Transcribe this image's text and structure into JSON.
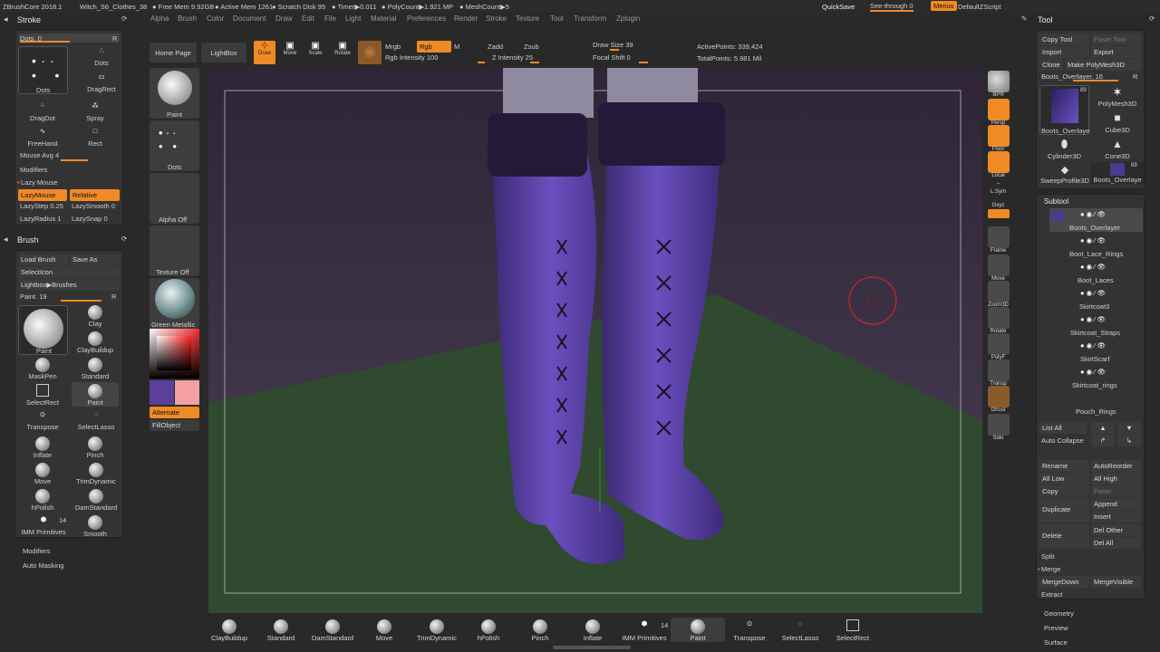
{
  "titlebar": {
    "app": "ZBrushCore 2018.1",
    "doc": "Witch_S6_Clothes_38",
    "free_mem": "● Free Mem 9.92GB",
    "active_mem": "● Active Mem 1261",
    "scratch": "● Scratch Disk 95",
    "timer": "● Timer▶0.011",
    "polycount": "● PolyCount▶1.921 MP",
    "meshcount": "● MeshCount▶5",
    "quicksave": "QuickSave",
    "seethrough": "See-through  0",
    "menus": "Menus",
    "script": "DefaultZScript"
  },
  "menubar": [
    "Alpha",
    "Brush",
    "Color",
    "Document",
    "Draw",
    "Edit",
    "File",
    "Light",
    "Material",
    "Preferences",
    "Render",
    "Stroke",
    "Texture",
    "Tool",
    "Transform",
    "Zplugin"
  ],
  "stroke": {
    "title": "Stroke",
    "dots_slider": "Dots. 0",
    "r": "R",
    "items": [
      "Dots",
      "Dots",
      "DragRect",
      "DragDot",
      "Spray",
      "FreeHand",
      "Rect"
    ],
    "mouse_avg": "Mouse Avg 4",
    "modifiers": "Modifiers",
    "lazy_mouse": "Lazy Mouse",
    "lazymouse_btn": "LazyMouse",
    "relative_btn": "Relative",
    "lazystep": "LazyStep 0.25",
    "lazysmooth": "LazySmooth 0",
    "lazyradius": "LazyRadius 1",
    "lazysnap": "LazySnap 0"
  },
  "brush": {
    "title": "Brush",
    "load": "Load Brush",
    "save": "Save As",
    "selecticon": "SelectIcon",
    "lightbox": "Lightbox▶Brushes",
    "paint_slider": "Paint. 19",
    "r": "R",
    "items": [
      "Paint",
      "Clay",
      "ClayBuildup",
      "MaskPen",
      "Standard",
      "SelectRect",
      "Paint",
      "Transpose",
      "SelectLasso",
      "Inflate",
      "Pinch",
      "Move",
      "TrimDynamic",
      "hPolish",
      "DamStandard",
      "IMM Primitives",
      "Smooth"
    ],
    "imm_count": "14",
    "modifiers": "Modifiers",
    "auto_masking": "Auto Masking"
  },
  "leftshelf": {
    "paint": "Paint",
    "dots": "Dots",
    "alpha": "Alpha Off",
    "texture": "Texture Off",
    "material": "Green Metallic",
    "alternate": "Alternate",
    "fillobject": "FillObject"
  },
  "topbar": {
    "home": "Home Page",
    "lightbox": "LightBox",
    "draw": "Draw",
    "move": "Move",
    "scale": "Scale",
    "rotate": "Rotate",
    "mrgb": "Mrgb",
    "rgb": "Rgb",
    "m": "M",
    "zadd": "Zadd",
    "zsub": "Zsub",
    "rgb_intensity": "Rgb Intensity 100",
    "z_intensity": "Z Intensity 25",
    "draw_size": "Draw Size 39",
    "focal_shift": "Focal Shift 0",
    "active_points": "ActivePoints: 339,424",
    "total_points": "TotalPoints: 5.981 Mil"
  },
  "righttools": [
    "BPR",
    "Persp",
    "Floor",
    "Local",
    "L.Sym",
    "Gxyz",
    "Frame",
    "Move",
    "Zoom3D",
    "Rotate",
    "PolyF",
    "Transp",
    "Ghost",
    "Solo"
  ],
  "tool": {
    "title": "Tool",
    "copy": "Copy Tool",
    "paste": "Paste Tool",
    "import": "Import",
    "export": "Export",
    "clone": "Clone",
    "make": "Make PolyMesh3D",
    "name_slider": "Boots_Overlayer. 16",
    "r": "R",
    "thumbs": [
      "Boots_Overlaye",
      "PolyMesh3D",
      "Cube3D",
      "Cylinder3D",
      "Cone3D",
      "SweepProfile3D",
      "Boots_Overlaye"
    ],
    "thumb_count": "89"
  },
  "subtool": {
    "title": "Subtool",
    "items": [
      "Boots_Overlayer",
      "Boot_Lace_Rings",
      "Boot_Laces",
      "Skirtcoat3",
      "Skirtcoat_Straps",
      "SkirtScarf",
      "Skirtcoat_rings",
      "Pouch_Rings"
    ],
    "list_all": "List All",
    "auto_collapse": "Auto Collapse",
    "rename": "Rename",
    "autoreorder": "AutoReorder",
    "all_low": "All Low",
    "all_high": "All High",
    "copy": "Copy",
    "paste": "Paste",
    "duplicate": "Duplicate",
    "append": "Append",
    "insert": "Insert",
    "delete": "Delete",
    "del_other": "Del Other",
    "del_all": "Del All",
    "split": "Split",
    "merge": "Merge",
    "mergedown": "MergeDown",
    "mergevisible": "MergeVisible",
    "extract": "Extract"
  },
  "bottom_sections": [
    "Geometry",
    "Preview",
    "Surface"
  ],
  "bottombar": [
    "ClayBuildup",
    "Standard",
    "DamStandard",
    "Move",
    "TrimDynamic",
    "hPolish",
    "Pinch",
    "Inflate",
    "IMM Primitives",
    "Paint",
    "Transpose",
    "SelectLasso",
    "SelectRect"
  ],
  "bottom_imm_count": "14",
  "colors": {
    "accent": "#f08a24",
    "primary_color": "#5c3f9a",
    "secondary_color": "#f2a0a0",
    "boots": "#5b3ea8",
    "floor": "#2f4a2f"
  }
}
